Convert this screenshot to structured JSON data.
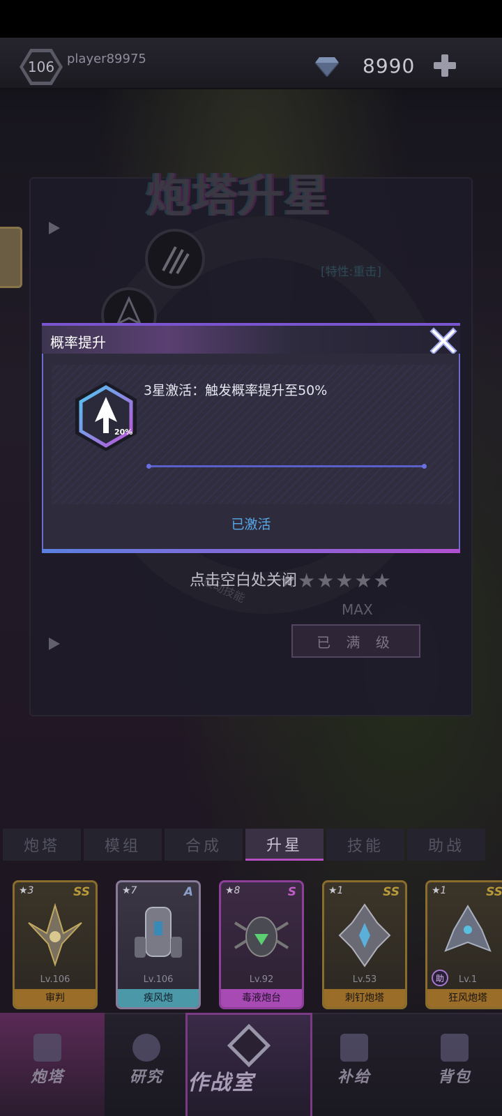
{
  "top_bar": {
    "level": "106",
    "player_name": "player89975",
    "currency_amount": "8990",
    "gem_icon": "diamond-gem-icon",
    "add_icon": "plus-icon"
  },
  "background_panel": {
    "title": "炮塔升星",
    "trait_text": "[特性:重击]",
    "skill_text": "被动技能",
    "stars": "★★★★★★",
    "max_label": "MAX",
    "max_button": "已 满 级",
    "close_hint": "点击空白处关闭"
  },
  "modal": {
    "title": "概率提升",
    "icon_badge": "20%",
    "description": "3星激活：触发概率提升至50%",
    "status": "已激活"
  },
  "tabs": [
    {
      "label": "炮塔",
      "active": false
    },
    {
      "label": "模组",
      "active": false
    },
    {
      "label": "合成",
      "active": false
    },
    {
      "label": "升星",
      "active": true
    },
    {
      "label": "技能",
      "active": false
    },
    {
      "label": "助战",
      "active": false
    }
  ],
  "cards": [
    {
      "stars": "★3",
      "rank": "SS",
      "level": "Lv.106",
      "name": "审判"
    },
    {
      "stars": "★7",
      "rank": "A",
      "level": "Lv.106",
      "name": "疾风炮"
    },
    {
      "stars": "★8",
      "rank": "S",
      "level": "Lv.92",
      "name": "毒液炮台"
    },
    {
      "stars": "★1",
      "rank": "SS",
      "level": "Lv.53",
      "name": "刺钉炮塔"
    },
    {
      "stars": "★1",
      "rank": "SS",
      "level": "Lv.1",
      "name": "狂风炮塔",
      "assist": "助"
    }
  ],
  "nav": [
    {
      "label": "炮塔"
    },
    {
      "label": "研究"
    },
    {
      "label": "作战室"
    },
    {
      "label": "补给"
    },
    {
      "label": "背包"
    }
  ],
  "colors": {
    "accent_purple": "#b44fc0",
    "accent_blue": "#58a8e8",
    "gold": "#9a6e28"
  }
}
